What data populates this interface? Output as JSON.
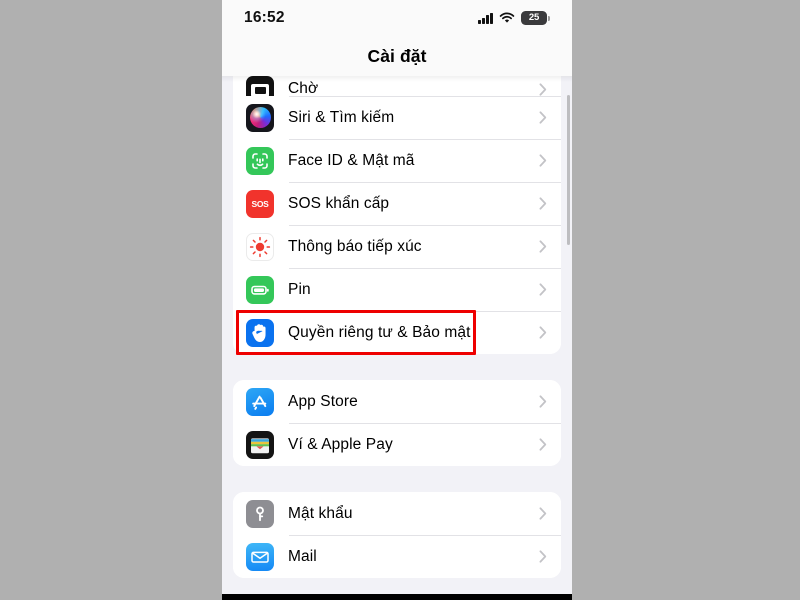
{
  "device": {
    "status_bar": {
      "time": "16:52",
      "cellular_icon": "cellular-signal-icon",
      "wifi_icon": "wifi-icon",
      "battery_icon": "battery-icon",
      "battery_percent": "25"
    },
    "nav_bar": {
      "title": "Cài đặt"
    }
  },
  "highlight": {
    "color": "#ee0000",
    "target": "Quyền riêng tư & Bảo mật"
  },
  "colors": {
    "page_background": "#f2f2f7",
    "card_background": "#ffffff",
    "outside_background": "#b0b0b0",
    "separator": "#e2e2e6",
    "chevron": "#c3c3c7",
    "green": "#34c759",
    "red": "#f1332c",
    "blue": "#0a72ef",
    "gray": "#8e8e93"
  },
  "settings": {
    "groups": [
      {
        "id": "group-system",
        "clipped_top": true,
        "rows": [
          {
            "label": "Chờ",
            "icon": "screen-time-icon",
            "chevron": "chevron-right-icon",
            "clipped": true,
            "highlighted": false
          },
          {
            "label": "Siri & Tìm kiếm",
            "icon": "siri-icon",
            "chevron": "chevron-right-icon",
            "clipped": false,
            "highlighted": false
          },
          {
            "label": "Face ID & Mật mã",
            "icon": "face-id-icon",
            "chevron": "chevron-right-icon",
            "clipped": false,
            "highlighted": false
          },
          {
            "label": "SOS khẩn cấp",
            "icon": "emergency-sos-icon",
            "chevron": "chevron-right-icon",
            "clipped": false,
            "highlighted": false
          },
          {
            "label": "Thông báo tiếp xúc",
            "icon": "exposure-notification-icon",
            "chevron": "chevron-right-icon",
            "clipped": false,
            "highlighted": false
          },
          {
            "label": "Pin",
            "icon": "battery-settings-icon",
            "chevron": "chevron-right-icon",
            "clipped": false,
            "highlighted": false
          },
          {
            "label": "Quyền riêng tư & Bảo mật",
            "icon": "privacy-hand-icon",
            "chevron": "chevron-right-icon",
            "clipped": false,
            "highlighted": true
          }
        ]
      },
      {
        "id": "group-store",
        "clipped_top": false,
        "rows": [
          {
            "label": "App Store",
            "icon": "app-store-icon",
            "chevron": "chevron-right-icon",
            "clipped": false,
            "highlighted": false
          },
          {
            "label": "Ví & Apple Pay",
            "icon": "wallet-icon",
            "chevron": "chevron-right-icon",
            "clipped": false,
            "highlighted": false
          }
        ]
      },
      {
        "id": "group-accounts",
        "clipped_top": false,
        "rows": [
          {
            "label": "Mật khẩu",
            "icon": "passwords-key-icon",
            "chevron": "chevron-right-icon",
            "clipped": false,
            "highlighted": false
          },
          {
            "label": "Mail",
            "icon": "mail-icon",
            "chevron": "chevron-right-icon",
            "clipped": false,
            "highlighted": false
          }
        ]
      }
    ]
  }
}
